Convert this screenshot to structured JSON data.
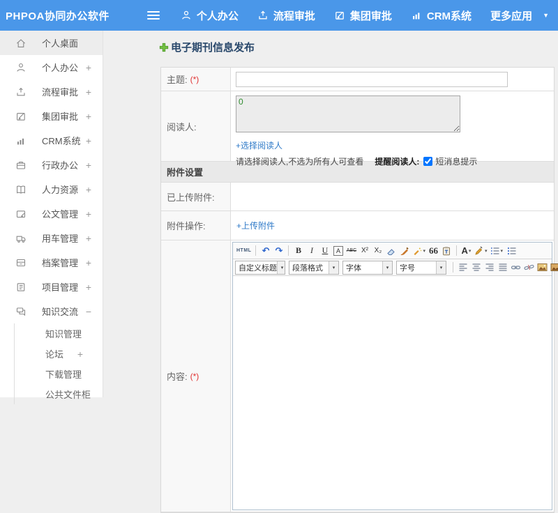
{
  "topbar": {
    "brand": "PHPOA协同办公软件",
    "nav": [
      {
        "label": "个人办公"
      },
      {
        "label": "流程审批"
      },
      {
        "label": "集团审批"
      },
      {
        "label": "CRM系统"
      },
      {
        "label": "更多应用"
      }
    ]
  },
  "icons": {
    "caret_down": "▼",
    "caret_small": "▾"
  },
  "sidebar": {
    "items": [
      {
        "label": "个人桌面",
        "expand": ""
      },
      {
        "label": "个人办公",
        "expand": "+"
      },
      {
        "label": "流程审批",
        "expand": "+"
      },
      {
        "label": "集团审批",
        "expand": "+"
      },
      {
        "label": "CRM系统",
        "expand": "+"
      },
      {
        "label": "行政办公",
        "expand": "+"
      },
      {
        "label": "人力资源",
        "expand": "+"
      },
      {
        "label": "公文管理",
        "expand": "+"
      },
      {
        "label": "用车管理",
        "expand": "+"
      },
      {
        "label": "档案管理",
        "expand": "+"
      },
      {
        "label": "项目管理",
        "expand": "+"
      },
      {
        "label": "知识交流",
        "expand": "−"
      }
    ],
    "subitems": [
      {
        "label": "知识管理",
        "expand": ""
      },
      {
        "label": "论坛",
        "expand": "+"
      },
      {
        "label": "下载管理",
        "expand": ""
      },
      {
        "label": "公共文件柜",
        "expand": ""
      }
    ]
  },
  "page": {
    "title": "电子期刊信息发布"
  },
  "form": {
    "subject_label": "主题:",
    "required": "(*)",
    "readers_label": "阅读人:",
    "readers_value": "0",
    "select_readers_link": "+选择阅读人",
    "readers_hint": "请选择阅读人,不选为所有人可查看",
    "remind_label": "提醒阅读人:",
    "sms_label": "短消息提示",
    "attach_header": "附件设置",
    "uploaded_label": "已上传附件:",
    "attach_op_label": "附件操作:",
    "upload_link": "+上传附件",
    "content_label": "内容:"
  },
  "editor": {
    "html_btn": "HTML",
    "bold": "B",
    "italic": "I",
    "underline": "U",
    "char_border": "A",
    "strike": "ABC",
    "superscript": "X²",
    "subscript": "X₂",
    "quote": "66",
    "font_color": "A",
    "selects": [
      "自定义标题",
      "段落格式",
      "字体",
      "字号"
    ]
  },
  "colors": {
    "topbar_blue": "#4a97e9",
    "link_blue": "#2f7ac8",
    "title_navy": "#29486b",
    "required_red": "#e03131",
    "readers_green": "#2e8b2e"
  }
}
